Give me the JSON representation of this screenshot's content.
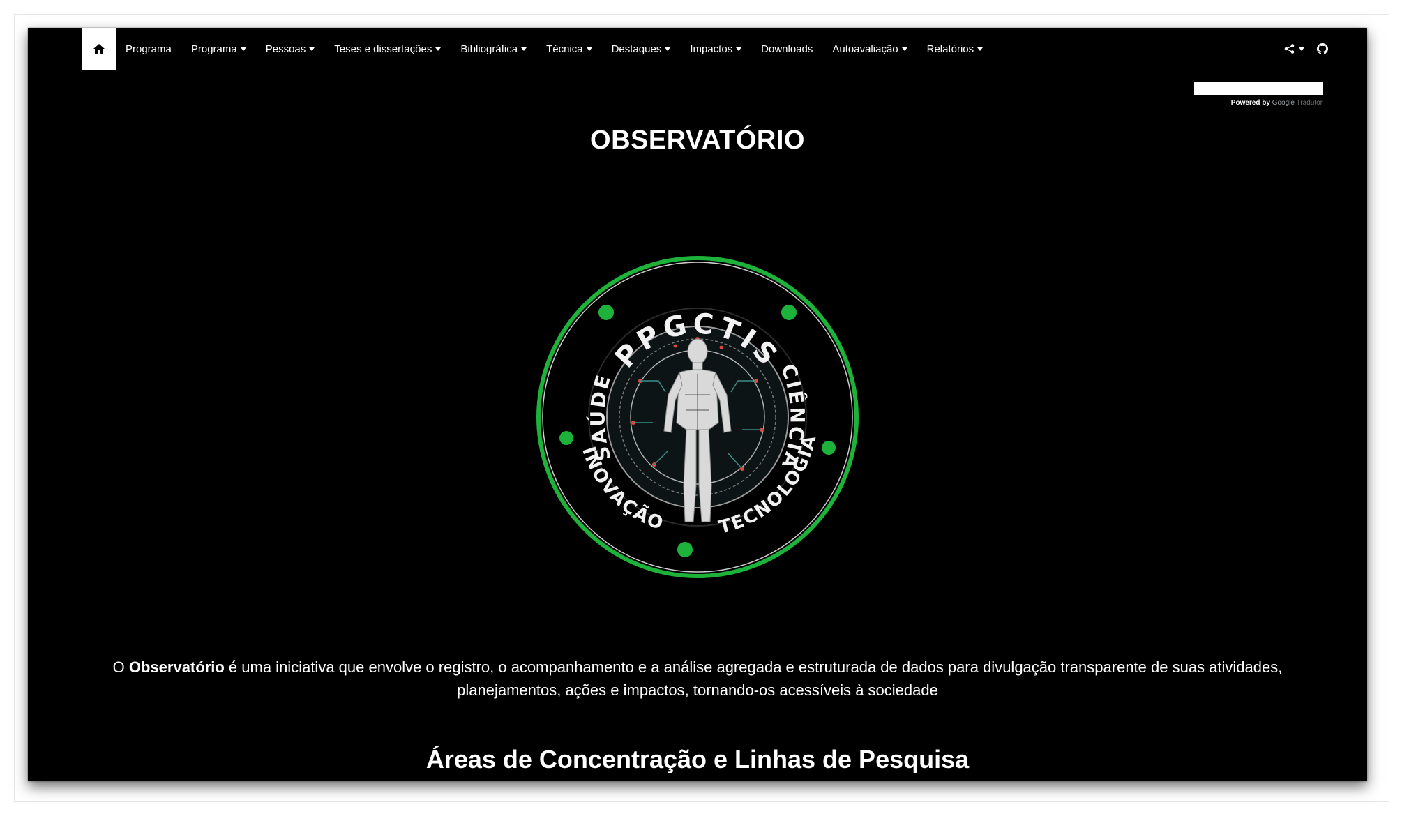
{
  "nav": {
    "items": [
      {
        "label": "Programa",
        "dropdown": false
      },
      {
        "label": "Programa",
        "dropdown": true
      },
      {
        "label": "Pessoas",
        "dropdown": true
      },
      {
        "label": "Teses e dissertações",
        "dropdown": true
      },
      {
        "label": "Bibliográfica",
        "dropdown": true
      },
      {
        "label": "Técnica",
        "dropdown": true
      },
      {
        "label": "Destaques",
        "dropdown": true
      },
      {
        "label": "Impactos",
        "dropdown": true
      },
      {
        "label": "Downloads",
        "dropdown": false
      },
      {
        "label": "Autoavaliação",
        "dropdown": true
      },
      {
        "label": "Relatórios",
        "dropdown": true
      }
    ],
    "icons": [
      "home-icon",
      "share-icon",
      "github-icon"
    ]
  },
  "translate": {
    "powered_by": "Powered by",
    "google": "Google",
    "service": "Tradutor"
  },
  "page": {
    "title": "OBSERVATÓRIO",
    "logo": {
      "top": "PPGCTIS",
      "left": "SAÚDE",
      "right": "CIÊNCIA",
      "bottom_left": "INOVAÇÃO",
      "bottom_right": "TECNOLOGIA",
      "ring_color": "#1db33a"
    },
    "intro_prefix": "O ",
    "intro_bold": "Observatório",
    "intro_rest": " é uma iniciativa que envolve o registro, o acompanhamento e a análise agregada e estruturada de dados para divulgação transparente de suas atividades, planejamentos, ações e impactos, tornando-os acessíveis à sociedade",
    "section_title": "Áreas de Concentração e Linhas de Pesquisa"
  }
}
